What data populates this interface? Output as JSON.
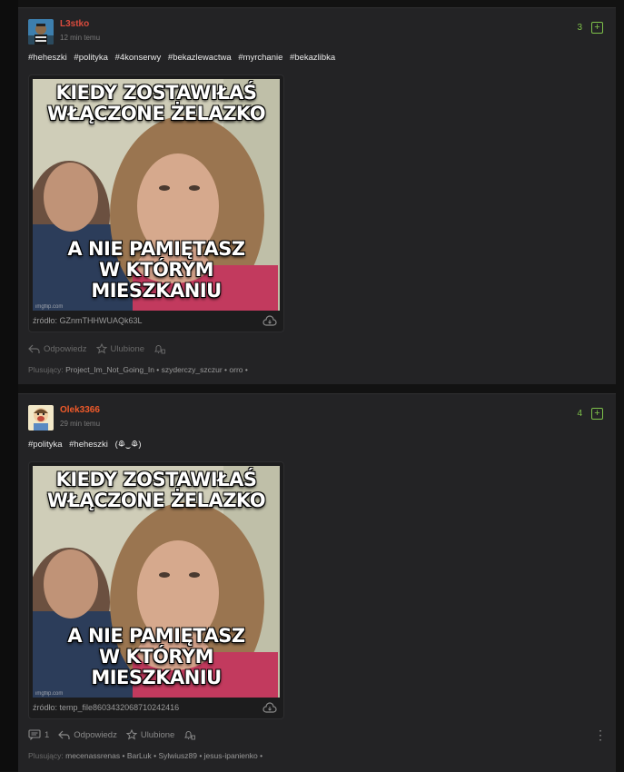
{
  "posts": [
    {
      "username": "L3stko",
      "username_color": "#d94b3d",
      "timestamp": "12 min temu",
      "votes": "3",
      "plus_symbol": "+",
      "tags": [
        "#heheszki",
        "#polityka",
        "#4konserwy",
        "#bekazlewactwa",
        "#myrchanie",
        "#bekazlibka"
      ],
      "tags_suffix": "",
      "meme_top": "KIEDY ZOSTAWIŁAŚ\nWŁĄCZONE ŻELAZKO",
      "meme_bottom": "A NIE PAMIĘTASZ\nW KTÓRYM MIESZKANIU",
      "watermark": "imgflip.com",
      "source": "źródło: GZnmTHHWUAQk63L",
      "comment_count": "",
      "reply_label": "Odpowiedz",
      "favorite_label": "Ulubione",
      "plus_label": "Plusujący:",
      "plusers": "Project_Im_Not_Going_In • szyderczy_szczur • orro •"
    },
    {
      "username": "Olek3366",
      "username_color": "#f05a2a",
      "timestamp": "29 min temu",
      "votes": "4",
      "plus_symbol": "+",
      "tags": [
        "#polityka",
        "#heheszki"
      ],
      "tags_suffix": "(ꖘ‿ꖘ)",
      "meme_top": "KIEDY ZOSTAWIŁAŚ\nWŁĄCZONE ŻELAZKO",
      "meme_bottom": "A NIE PAMIĘTASZ\nW KTÓRYM MIESZKANIU",
      "watermark": "imgflip.com",
      "source": "źródło: temp_file8603432068710242416",
      "comment_count": "1",
      "reply_label": "Odpowiedz",
      "favorite_label": "Ulubione",
      "plus_label": "Plusujący:",
      "plusers": "mecenassrenas • BarLuk • Sylwiusz89 • jesus-ipanienko •"
    }
  ],
  "colors": {
    "vote_green": "#7ec24a",
    "card_bg": "#232325",
    "page_bg": "#121212"
  }
}
